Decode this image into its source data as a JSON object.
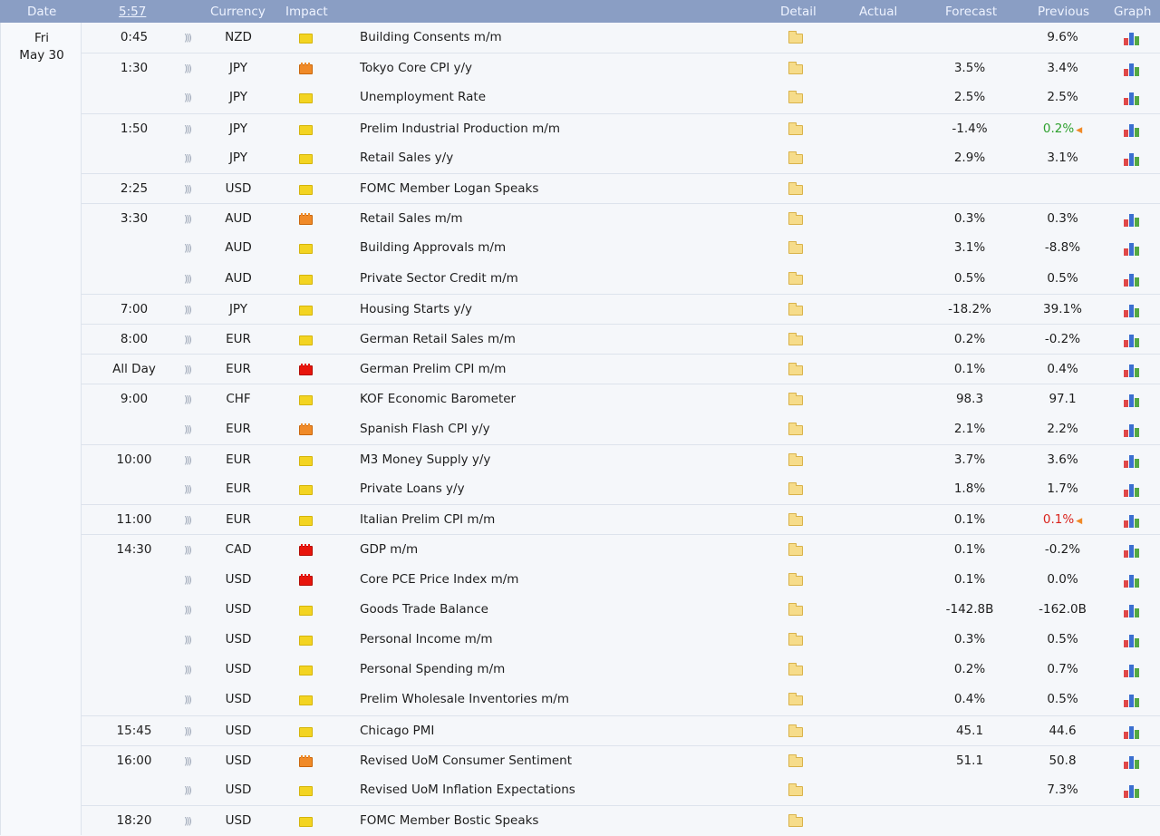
{
  "header": {
    "date": "Date",
    "time": "5:57",
    "currency": "Currency",
    "impact": "Impact",
    "detail": "Detail",
    "actual": "Actual",
    "forecast": "Forecast",
    "previous": "Previous",
    "graph": "Graph"
  },
  "day": {
    "weekday": "Fri",
    "date": "May 30"
  },
  "colors": {
    "header_bg": "#8a9ec4",
    "low": "#f3d422",
    "medium": "#f08a28",
    "high": "#e8150c",
    "better": "#2da02d",
    "worse": "#d9221b"
  },
  "icons": [
    "sound-icon",
    "impact-icon",
    "detail-folder-icon",
    "graph-icon",
    "revision-arrow-icon"
  ],
  "events": [
    {
      "time": "0:45",
      "currency": "NZD",
      "impact": "low",
      "event": "Building Consents m/m",
      "actual": "",
      "forecast": "",
      "previous": "9.6%",
      "graph": true,
      "group_start": true
    },
    {
      "time": "1:30",
      "currency": "JPY",
      "impact": "medium",
      "event": "Tokyo Core CPI y/y",
      "actual": "",
      "forecast": "3.5%",
      "previous": "3.4%",
      "graph": true,
      "group_start": true
    },
    {
      "time": "",
      "currency": "JPY",
      "impact": "low",
      "event": "Unemployment Rate",
      "actual": "",
      "forecast": "2.5%",
      "previous": "2.5%",
      "graph": true,
      "group_start": false
    },
    {
      "time": "1:50",
      "currency": "JPY",
      "impact": "low",
      "event": "Prelim Industrial Production m/m",
      "actual": "",
      "forecast": "-1.4%",
      "previous": "0.2%",
      "previous_state": "up",
      "revised": true,
      "graph": true,
      "group_start": true
    },
    {
      "time": "",
      "currency": "JPY",
      "impact": "low",
      "event": "Retail Sales y/y",
      "actual": "",
      "forecast": "2.9%",
      "previous": "3.1%",
      "graph": true,
      "group_start": false
    },
    {
      "time": "2:25",
      "currency": "USD",
      "impact": "low",
      "event": "FOMC Member Logan Speaks",
      "actual": "",
      "forecast": "",
      "previous": "",
      "graph": false,
      "group_start": true
    },
    {
      "time": "3:30",
      "currency": "AUD",
      "impact": "medium",
      "event": "Retail Sales m/m",
      "actual": "",
      "forecast": "0.3%",
      "previous": "0.3%",
      "graph": true,
      "group_start": true
    },
    {
      "time": "",
      "currency": "AUD",
      "impact": "low",
      "event": "Building Approvals m/m",
      "actual": "",
      "forecast": "3.1%",
      "previous": "-8.8%",
      "graph": true,
      "group_start": false
    },
    {
      "time": "",
      "currency": "AUD",
      "impact": "low",
      "event": "Private Sector Credit m/m",
      "actual": "",
      "forecast": "0.5%",
      "previous": "0.5%",
      "graph": true,
      "group_start": false
    },
    {
      "time": "7:00",
      "currency": "JPY",
      "impact": "low",
      "event": "Housing Starts y/y",
      "actual": "",
      "forecast": "-18.2%",
      "previous": "39.1%",
      "graph": true,
      "group_start": true
    },
    {
      "time": "8:00",
      "currency": "EUR",
      "impact": "low",
      "event": "German Retail Sales m/m",
      "actual": "",
      "forecast": "0.2%",
      "previous": "-0.2%",
      "graph": true,
      "group_start": true
    },
    {
      "time": "All Day",
      "currency": "EUR",
      "impact": "high",
      "event": "German Prelim CPI m/m",
      "actual": "",
      "forecast": "0.1%",
      "previous": "0.4%",
      "graph": true,
      "group_start": true
    },
    {
      "time": "9:00",
      "currency": "CHF",
      "impact": "low",
      "event": "KOF Economic Barometer",
      "actual": "",
      "forecast": "98.3",
      "previous": "97.1",
      "graph": true,
      "group_start": true
    },
    {
      "time": "",
      "currency": "EUR",
      "impact": "medium",
      "event": "Spanish Flash CPI y/y",
      "actual": "",
      "forecast": "2.1%",
      "previous": "2.2%",
      "graph": true,
      "group_start": false
    },
    {
      "time": "10:00",
      "currency": "EUR",
      "impact": "low",
      "event": "M3 Money Supply y/y",
      "actual": "",
      "forecast": "3.7%",
      "previous": "3.6%",
      "graph": true,
      "group_start": true
    },
    {
      "time": "",
      "currency": "EUR",
      "impact": "low",
      "event": "Private Loans y/y",
      "actual": "",
      "forecast": "1.8%",
      "previous": "1.7%",
      "graph": true,
      "group_start": false
    },
    {
      "time": "11:00",
      "currency": "EUR",
      "impact": "low",
      "event": "Italian Prelim CPI m/m",
      "actual": "",
      "forecast": "0.1%",
      "previous": "0.1%",
      "previous_state": "down",
      "revised": true,
      "graph": true,
      "group_start": true
    },
    {
      "time": "14:30",
      "currency": "CAD",
      "impact": "high",
      "event": "GDP m/m",
      "actual": "",
      "forecast": "0.1%",
      "previous": "-0.2%",
      "graph": true,
      "group_start": true
    },
    {
      "time": "",
      "currency": "USD",
      "impact": "high",
      "event": "Core PCE Price Index m/m",
      "actual": "",
      "forecast": "0.1%",
      "previous": "0.0%",
      "graph": true,
      "group_start": false
    },
    {
      "time": "",
      "currency": "USD",
      "impact": "low",
      "event": "Goods Trade Balance",
      "actual": "",
      "forecast": "-142.8B",
      "previous": "-162.0B",
      "graph": true,
      "group_start": false
    },
    {
      "time": "",
      "currency": "USD",
      "impact": "low",
      "event": "Personal Income m/m",
      "actual": "",
      "forecast": "0.3%",
      "previous": "0.5%",
      "graph": true,
      "group_start": false
    },
    {
      "time": "",
      "currency": "USD",
      "impact": "low",
      "event": "Personal Spending m/m",
      "actual": "",
      "forecast": "0.2%",
      "previous": "0.7%",
      "graph": true,
      "group_start": false
    },
    {
      "time": "",
      "currency": "USD",
      "impact": "low",
      "event": "Prelim Wholesale Inventories m/m",
      "actual": "",
      "forecast": "0.4%",
      "previous": "0.5%",
      "graph": true,
      "group_start": false
    },
    {
      "time": "15:45",
      "currency": "USD",
      "impact": "low",
      "event": "Chicago PMI",
      "actual": "",
      "forecast": "45.1",
      "previous": "44.6",
      "graph": true,
      "group_start": true
    },
    {
      "time": "16:00",
      "currency": "USD",
      "impact": "medium",
      "event": "Revised UoM Consumer Sentiment",
      "actual": "",
      "forecast": "51.1",
      "previous": "50.8",
      "graph": true,
      "group_start": true
    },
    {
      "time": "",
      "currency": "USD",
      "impact": "low",
      "event": "Revised UoM Inflation Expectations",
      "actual": "",
      "forecast": "",
      "previous": "7.3%",
      "graph": true,
      "group_start": false
    },
    {
      "time": "18:20",
      "currency": "USD",
      "impact": "low",
      "event": "FOMC Member Bostic Speaks",
      "actual": "",
      "forecast": "",
      "previous": "",
      "graph": false,
      "group_start": true
    }
  ]
}
